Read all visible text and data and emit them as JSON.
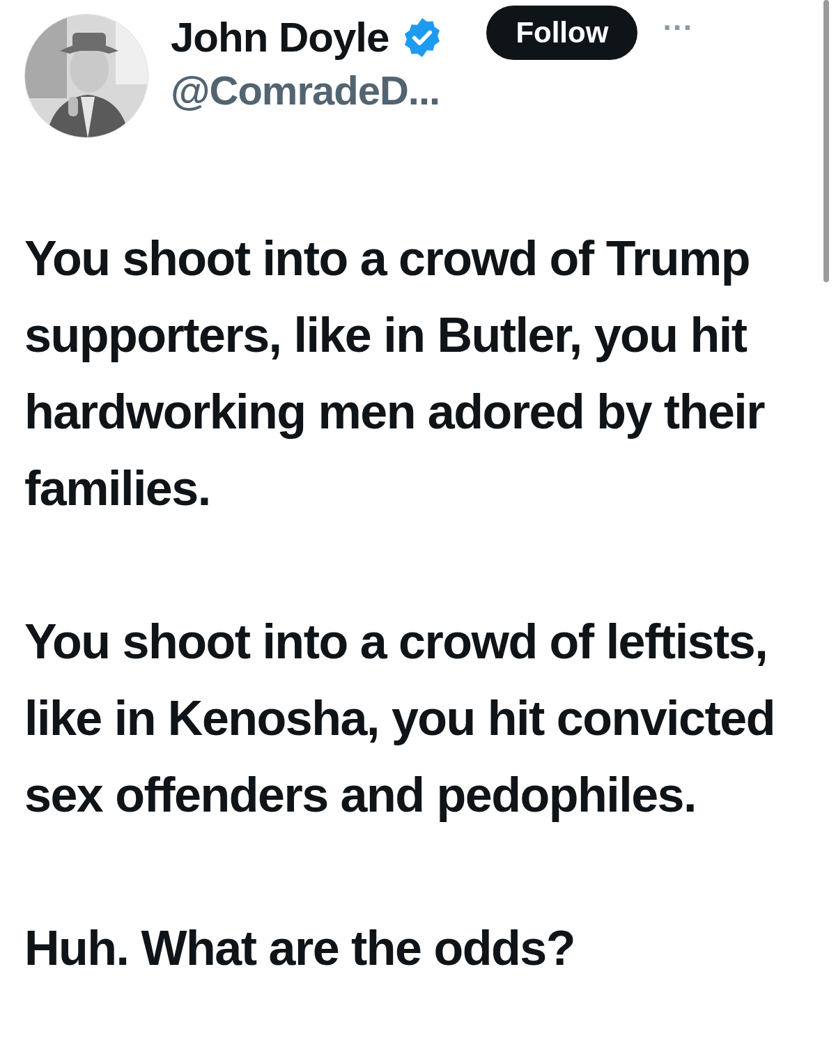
{
  "author": {
    "name": "John Doyle",
    "verified": true,
    "handle": "@ComradeD..."
  },
  "follow_button": "Follow",
  "more_button": "···",
  "paragraphs": [
    "You shoot into a crowd of Trump supporters, like in Butler, you hit hardworking men adored by their families.",
    "You shoot into a crowd of leftists, like in Kenosha, you hit convicted sex offenders and pedophiles.",
    "Huh. What are the odds?"
  ]
}
